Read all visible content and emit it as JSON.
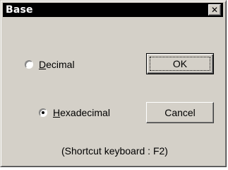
{
  "window": {
    "title": "Base",
    "close_symbol": "✕"
  },
  "options": {
    "decimal": {
      "label_mnemonic": "D",
      "label_rest": "ecimal",
      "selected": false
    },
    "hexadecimal": {
      "label_mnemonic": "H",
      "label_rest": "exadecimal",
      "selected": true
    }
  },
  "buttons": {
    "ok_label": "OK",
    "cancel_label": "Cancel"
  },
  "hint": {
    "shortcut_text": "(Shortcut keyboard : F2)"
  },
  "colors": {
    "face": "#d4d0c8",
    "titlebar": "#000000",
    "title_text": "#ffffff"
  }
}
